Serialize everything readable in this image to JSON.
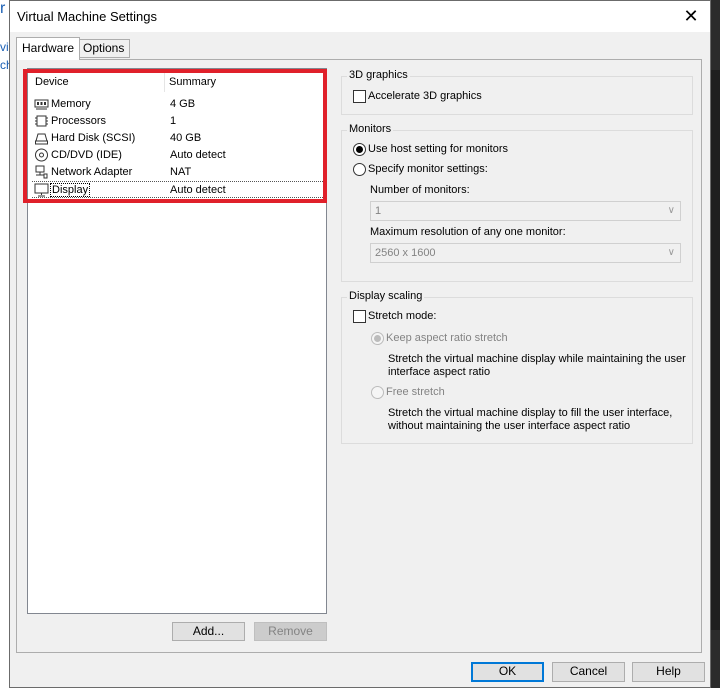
{
  "window": {
    "title": "Virtual Machine Settings",
    "close_glyph": "✕"
  },
  "tabs": [
    {
      "label": "Hardware",
      "active": true
    },
    {
      "label": "Options",
      "active": false
    }
  ],
  "device_list": {
    "headers": {
      "device": "Device",
      "summary": "Summary"
    },
    "rows": [
      {
        "name": "Memory",
        "summary": "4 GB",
        "icon": "memory-icon"
      },
      {
        "name": "Processors",
        "summary": "1",
        "icon": "processor-icon"
      },
      {
        "name": "Hard Disk (SCSI)",
        "summary": "40 GB",
        "icon": "hard-disk-icon"
      },
      {
        "name": "CD/DVD (IDE)",
        "summary": "Auto detect",
        "icon": "cd-dvd-icon"
      },
      {
        "name": "Network Adapter",
        "summary": "NAT",
        "icon": "network-adapter-icon"
      },
      {
        "name": "Display",
        "summary": "Auto detect",
        "icon": "display-icon",
        "selected": true
      }
    ],
    "add_label": "Add...",
    "remove_label": "Remove"
  },
  "graphics3d": {
    "title": "3D graphics",
    "accelerate_label": "Accelerate 3D graphics",
    "accelerate_checked": false
  },
  "monitors": {
    "title": "Monitors",
    "use_host_label": "Use host setting for monitors",
    "specify_label": "Specify monitor settings:",
    "selected": "use_host",
    "number_label": "Number of monitors:",
    "number_value": "1",
    "max_res_label": "Maximum resolution of any one monitor:",
    "max_res_value": "2560 x 1600"
  },
  "display_scaling": {
    "title": "Display scaling",
    "stretch_label": "Stretch mode:",
    "stretch_checked": false,
    "keep_aspect_label": "Keep aspect ratio stretch",
    "keep_aspect_desc_1": "Stretch the virtual machine display while maintaining the user",
    "keep_aspect_desc_2": "interface aspect ratio",
    "free_label": "Free stretch",
    "free_desc_1": "Stretch the virtual machine display to fill the user interface,",
    "free_desc_2": "without maintaining the user interface aspect ratio"
  },
  "footer": {
    "ok": "OK",
    "cancel": "Cancel",
    "help": "Help"
  },
  "colors": {
    "highlight": "#e0202a",
    "default_button_border": "#0078d7"
  }
}
